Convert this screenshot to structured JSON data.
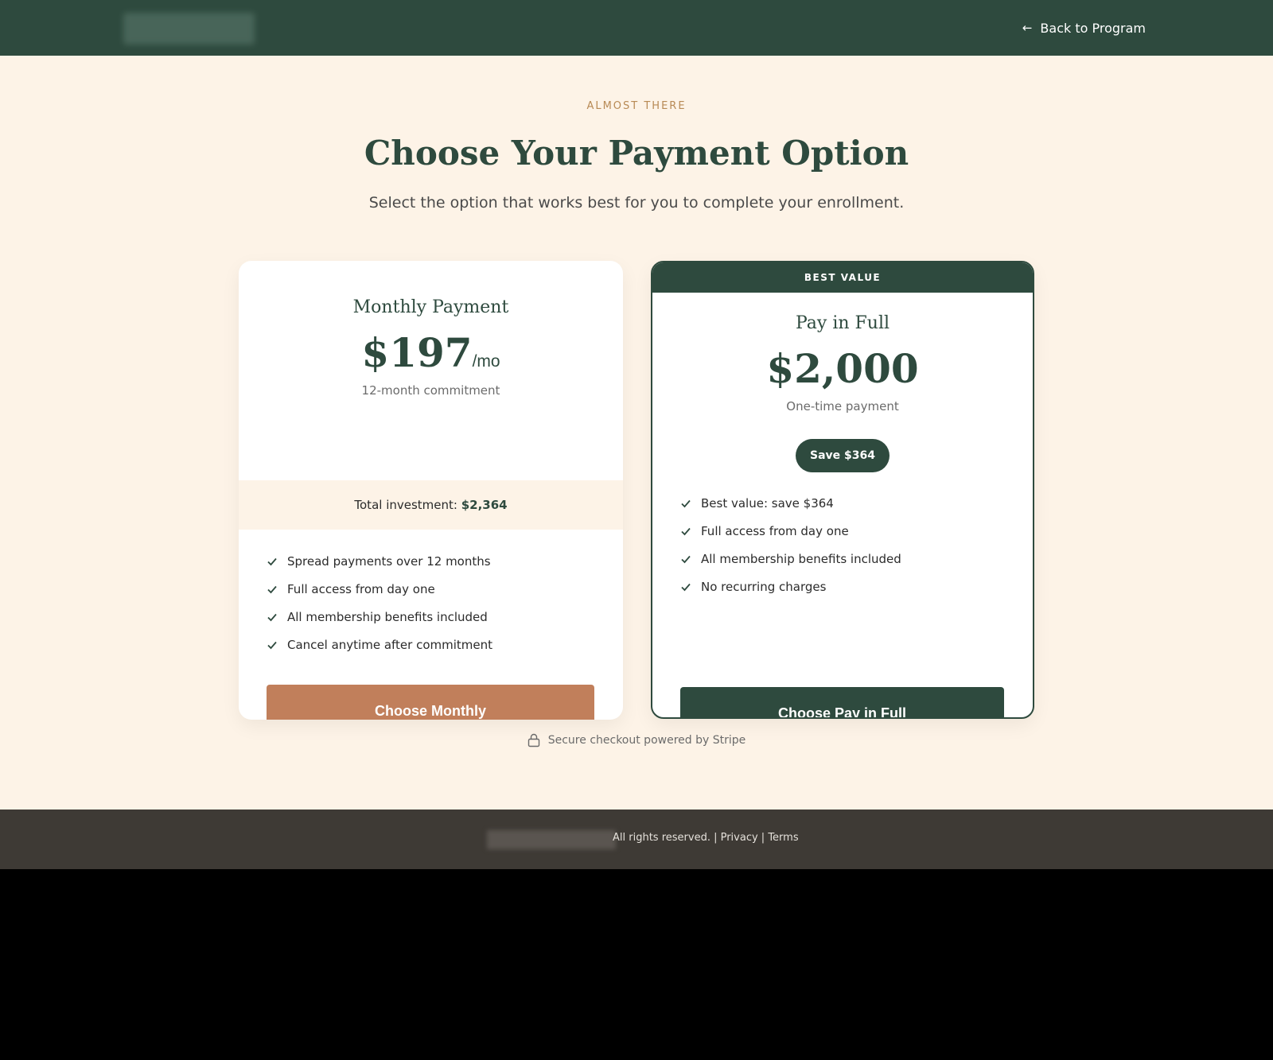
{
  "header": {
    "back_label": "Back to Program",
    "back_icon": "arrow-left-icon"
  },
  "hero": {
    "eyebrow": "ALMOST THERE",
    "title": "Choose Your Payment Option",
    "subtitle": "Select the option that works best for you to complete your enrollment."
  },
  "monthly": {
    "name": "Monthly Payment",
    "price": "$197",
    "unit": "/mo",
    "note": "12-month commitment",
    "total_label": "Total investment: ",
    "total_value": "$2,364",
    "features": [
      "Spread payments over 12 months",
      "Full access from day one",
      "All membership benefits included",
      "Cancel anytime after commitment"
    ],
    "button": "Choose Monthly"
  },
  "full": {
    "ribbon": "BEST VALUE",
    "name": "Pay in Full",
    "price": "$2,000",
    "note": "One-time payment",
    "save_badge": "Save $364",
    "features": [
      "Best value: save $364",
      "Full access from day one",
      "All membership benefits included",
      "No recurring charges"
    ],
    "button": "Choose Pay in Full"
  },
  "secure": {
    "text": "Secure checkout powered by Stripe",
    "icon": "lock-icon"
  },
  "footer": {
    "rights": "All rights reserved. | ",
    "privacy": "Privacy",
    "sep": " | ",
    "terms": "Terms"
  },
  "colors": {
    "brand_green": "#2e4a3e",
    "accent_terracotta": "#c17f5b",
    "cream": "#fdf3e7",
    "eyebrow_gold": "#b88a55",
    "footer_bg": "#3e3a35"
  }
}
